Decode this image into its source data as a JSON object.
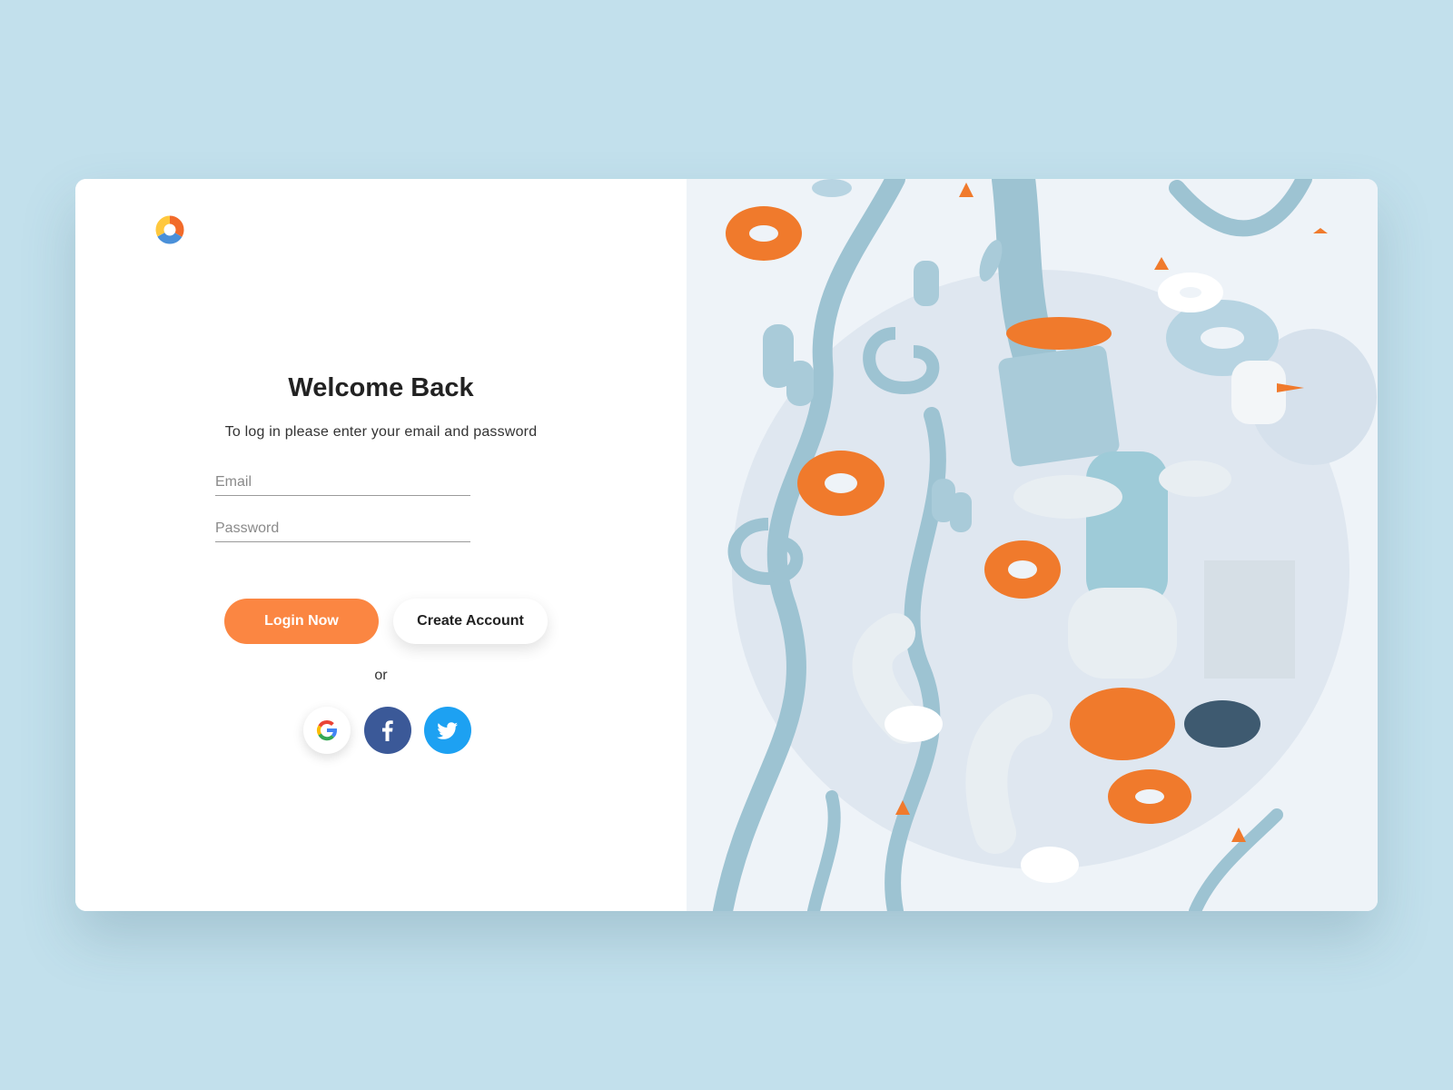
{
  "brand": {
    "logo_icon": "brand-donut-logo-icon"
  },
  "login": {
    "title": "Welcome Back",
    "subtitle": "To log in please enter your email and password",
    "email_placeholder": "Email",
    "email_value": "",
    "password_placeholder": "Password",
    "password_value": "",
    "login_label": "Login Now",
    "create_label": "Create Account",
    "or_label": "or"
  },
  "social": [
    {
      "name": "Google",
      "icon": "google-icon"
    },
    {
      "name": "Facebook",
      "icon": "facebook-icon"
    },
    {
      "name": "Twitter",
      "icon": "twitter-icon"
    }
  ],
  "colors": {
    "background": "#c2e0ec",
    "accent": "#fb8642",
    "facebook": "#3b5998",
    "twitter": "#1da1f2",
    "vine": "#9dc3d2"
  }
}
